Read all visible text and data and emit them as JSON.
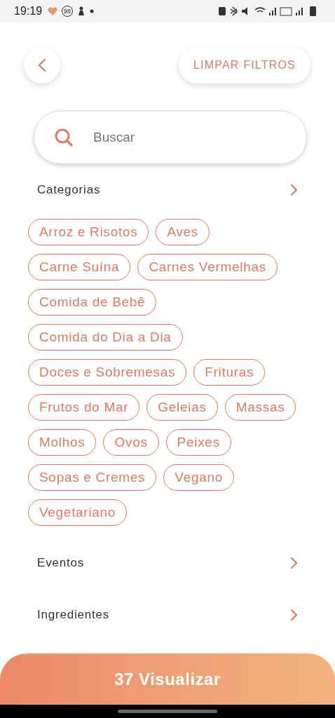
{
  "status_bar": {
    "time": "19:19",
    "badge": "98"
  },
  "header": {
    "clear_button": "LIMPAR FILTROS"
  },
  "search": {
    "placeholder": "Buscar"
  },
  "sections": [
    {
      "title": "Categorias",
      "chips": [
        {
          "label": "Arroz e Risotos",
          "selected": false
        },
        {
          "label": "Aves",
          "selected": false
        },
        {
          "label": "Carne Suína",
          "selected": false
        },
        {
          "label": "Carnes Vermelhas",
          "selected": false
        },
        {
          "label": "Comida de Bebê",
          "selected": false
        },
        {
          "label": "Comida do Dia a Dia",
          "selected": false
        },
        {
          "label": "Doces e Sobremesas",
          "selected": false
        },
        {
          "label": "Frituras",
          "selected": false
        },
        {
          "label": "Frutos do Mar",
          "selected": false
        },
        {
          "label": "Geleias",
          "selected": false
        },
        {
          "label": "Massas",
          "selected": false
        },
        {
          "label": "Molhos",
          "selected": false
        },
        {
          "label": "Ovos",
          "selected": false
        },
        {
          "label": "Peixes",
          "selected": false
        },
        {
          "label": "Sopas e Cremes",
          "selected": false
        },
        {
          "label": "Vegano",
          "selected": false
        },
        {
          "label": "Vegetariano",
          "selected": false
        }
      ]
    },
    {
      "title": "Eventos"
    },
    {
      "title": "Ingredientes"
    }
  ],
  "action_button": "37 Visualizar"
}
